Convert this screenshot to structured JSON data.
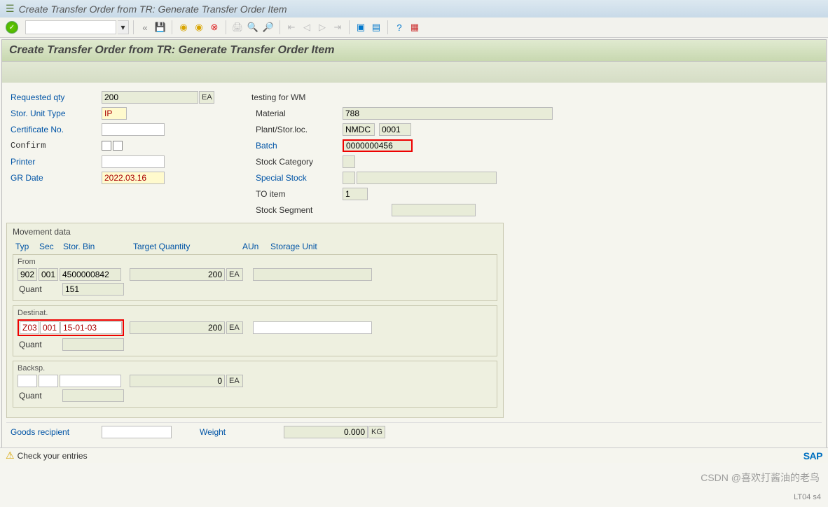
{
  "window": {
    "title": "Create Transfer Order from TR: Generate Transfer Order Item"
  },
  "page": {
    "title": "Create Transfer Order from TR: Generate Transfer Order Item"
  },
  "left": {
    "req_qty_lbl": "Requested qty",
    "req_qty": "200",
    "req_qty_unit": "EA",
    "sut_lbl": "Stor. Unit Type",
    "sut": "IP",
    "cert_lbl": "Certificate No.",
    "cert": "",
    "confirm_lbl": "Confirm",
    "printer_lbl": "Printer",
    "printer": "",
    "grdate_lbl": "GR Date",
    "grdate": "2022.03.16"
  },
  "right": {
    "desc": "testing for WM",
    "material_lbl": "Material",
    "material": "788",
    "plant_lbl": "Plant/Stor.loc.",
    "plant": "NMDC",
    "storloc": "0001",
    "batch_lbl": "Batch",
    "batch": "0000000456",
    "stockcat_lbl": "Stock Category",
    "stockcat": "",
    "special_lbl": "Special Stock",
    "special1": "",
    "special2": "",
    "toitem_lbl": "TO item",
    "toitem": "1",
    "stockseg_lbl": "Stock Segment",
    "stockseg": ""
  },
  "movement": {
    "title": "Movement data",
    "hdr_typ": "Typ",
    "hdr_sec": "Sec",
    "hdr_bin": "Stor. Bin",
    "hdr_tqty": "Target Quantity",
    "hdr_aun": "AUn",
    "hdr_su": "Storage Unit",
    "from": {
      "title": "From",
      "typ": "902",
      "sec": "001",
      "bin": "4500000842",
      "qty": "200",
      "aun": "EA",
      "su": "",
      "quant_lbl": "Quant",
      "quant": "151"
    },
    "dest": {
      "title": "Destinat.",
      "typ": "Z03",
      "sec": "001",
      "bin": "15-01-03",
      "qty": "200",
      "aun": "EA",
      "su": "",
      "quant_lbl": "Quant",
      "quant": ""
    },
    "back": {
      "title": "Backsp.",
      "typ": "",
      "sec": "",
      "bin": "",
      "qty": "0",
      "aun": "EA",
      "su": "",
      "quant_lbl": "Quant",
      "quant": ""
    }
  },
  "footer": {
    "goods_rcpt_lbl": "Goods recipient",
    "goods_rcpt": "",
    "weight_lbl": "Weight",
    "weight": "0.000",
    "weight_unit": "KG"
  },
  "status": {
    "msg": "Check your entries",
    "sap": "SAP"
  },
  "watermark": "CSDN @喜欢打酱油的老鸟",
  "tcode_corner": "LT04     s4"
}
